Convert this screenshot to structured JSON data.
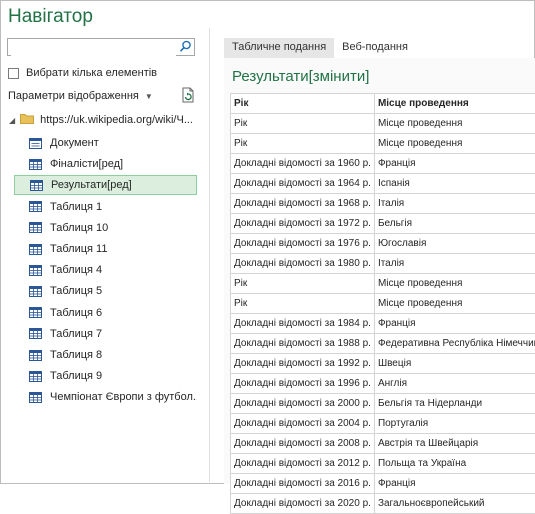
{
  "window": {
    "title": "Навігатор"
  },
  "search": {
    "value": "",
    "placeholder": ""
  },
  "multi_select": {
    "label": "Вибрати кілька елементів",
    "checked": false
  },
  "display_options": {
    "label": "Параметри відображення"
  },
  "tree": {
    "root_label": "https://uk.wikipedia.org/wiki/Ч...",
    "items": [
      {
        "label": "Документ",
        "icon": "document-icon"
      },
      {
        "label": "Фіналісти[ред]",
        "icon": "table-icon"
      },
      {
        "label": "Результати[ред]",
        "icon": "table-icon",
        "selected": true
      },
      {
        "label": "Таблиця 1",
        "icon": "table-icon"
      },
      {
        "label": "Таблиця 10",
        "icon": "table-icon"
      },
      {
        "label": "Таблиця 11",
        "icon": "table-icon"
      },
      {
        "label": "Таблиця 4",
        "icon": "table-icon"
      },
      {
        "label": "Таблиця 5",
        "icon": "table-icon"
      },
      {
        "label": "Таблиця 6",
        "icon": "table-icon"
      },
      {
        "label": "Таблиця 7",
        "icon": "table-icon"
      },
      {
        "label": "Таблиця 8",
        "icon": "table-icon"
      },
      {
        "label": "Таблиця 9",
        "icon": "table-icon"
      },
      {
        "label": "Чемпіонат Європи з футбол...",
        "icon": "table-icon"
      }
    ]
  },
  "tabs": [
    {
      "label": "Табличне подання",
      "active": true
    },
    {
      "label": "Веб-подання",
      "active": false
    }
  ],
  "preview": {
    "title": "Результати[змінити]",
    "headers": [
      "Рік",
      "Місце проведення"
    ],
    "rows": [
      [
        "Рік",
        "Місце проведення"
      ],
      [
        "Рік",
        "Місце проведення"
      ],
      [
        "Докладні відомості за 1960 р.",
        "Франція"
      ],
      [
        "Докладні відомості за 1964 р.",
        "Іспанія"
      ],
      [
        "Докладні відомості за 1968 р.",
        "Італія"
      ],
      [
        "Докладні відомості за 1972 р.",
        "Бельгія"
      ],
      [
        "Докладні відомості за 1976 р.",
        "Югославія"
      ],
      [
        "Докладні відомості за 1980 р.",
        "Італія"
      ],
      [
        "Рік",
        "Місце проведення"
      ],
      [
        "Рік",
        "Місце проведення"
      ],
      [
        "Докладні відомості за 1984 р.",
        "Франція"
      ],
      [
        "Докладні відомості за 1988 р.",
        "Федеративна Республіка Німеччина"
      ],
      [
        "Докладні відомості за 1992 р.",
        "Швеція"
      ],
      [
        "Докладні відомості за 1996 р.",
        "Англія"
      ],
      [
        "Докладні відомості за 2000 р.",
        "Бельгія та Нідерланди"
      ],
      [
        "Докладні відомості за 2004 р.",
        "Португалія"
      ],
      [
        "Докладні відомості за 2008 р.",
        "Австрія та Швейцарія"
      ],
      [
        "Докладні відомості за 2012 р.",
        "Польща та Україна"
      ],
      [
        "Докладні відомості за 2016 р.",
        "Франція"
      ],
      [
        "Докладні відомості за 2020 р.",
        "Загальноєвропейський"
      ]
    ]
  },
  "colors": {
    "accent": "#217346",
    "selected_bg": "#dcefdf",
    "selected_border": "#8fcf9f",
    "table_icon": "#2b5797"
  }
}
